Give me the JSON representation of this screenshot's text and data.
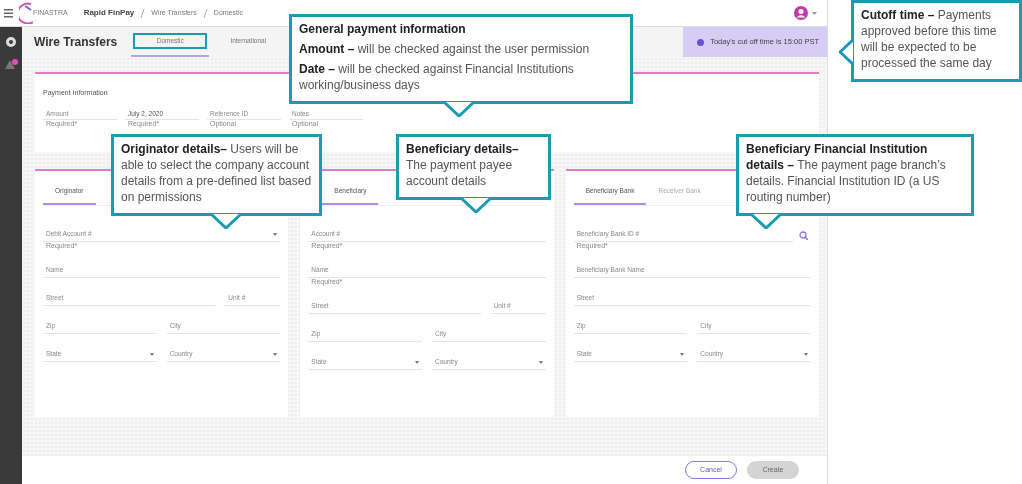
{
  "app_bar": {
    "logo": "FINASTRA",
    "app_name": "Rapid FinPay",
    "breadcrumb": [
      "Wire Transfers",
      "Domestic"
    ]
  },
  "page": {
    "title": "Wire Transfers",
    "tabs": [
      {
        "label": "Domestic",
        "selected": true,
        "highlighted": true
      },
      {
        "label": "International",
        "selected": false,
        "highlighted": false
      }
    ],
    "cutoff_banner": "Today's cut off time is 15:00 PST"
  },
  "payment_information": {
    "title": "Payment Information",
    "fields": [
      {
        "label": "Amount",
        "hint": "Required*",
        "filled": false
      },
      {
        "label": "July 2, 2020",
        "hint": "Required*",
        "filled": true
      },
      {
        "label": "Reference ID",
        "hint": "Optional",
        "filled": false
      },
      {
        "label": "Notes",
        "hint": "Optional",
        "filled": false
      }
    ]
  },
  "panels": [
    {
      "tabs": [
        {
          "label": "Originator",
          "selected": true
        }
      ],
      "rows": [
        [
          {
            "label": "Debit Account #",
            "kind": "select",
            "hint": "Required*"
          }
        ],
        [
          {
            "label": "Name",
            "kind": "text"
          }
        ],
        [
          {
            "label": "Street",
            "kind": "text"
          },
          {
            "label": "Unit #",
            "kind": "text",
            "narrow": true
          }
        ],
        [
          {
            "label": "Zip",
            "kind": "text"
          },
          {
            "label": "City",
            "kind": "text"
          }
        ],
        [
          {
            "label": "State",
            "kind": "select"
          },
          {
            "label": "Country",
            "kind": "select"
          }
        ]
      ]
    },
    {
      "tabs": [
        {
          "label": "Beneficiary",
          "selected": true
        }
      ],
      "rows": [
        [
          {
            "label": "Account #",
            "kind": "text",
            "hint": "Required*"
          }
        ],
        [
          {
            "label": "Name",
            "kind": "text",
            "hint": "Required*"
          }
        ],
        [
          {
            "label": "Street",
            "kind": "text"
          },
          {
            "label": "Unit #",
            "kind": "text",
            "narrow": true
          }
        ],
        [
          {
            "label": "Zip",
            "kind": "text"
          },
          {
            "label": "City",
            "kind": "text"
          }
        ],
        [
          {
            "label": "State",
            "kind": "select"
          },
          {
            "label": "Country",
            "kind": "select"
          }
        ]
      ]
    },
    {
      "tabs": [
        {
          "label": "Beneficiary Bank",
          "selected": true
        },
        {
          "label": "Receiver Bank",
          "selected": false
        }
      ],
      "rows": [
        [
          {
            "label": "Beneficiary Bank ID #",
            "kind": "search",
            "hint": "Required*"
          }
        ],
        [
          {
            "label": "Beneficiary Bank Name",
            "kind": "text"
          }
        ],
        [
          {
            "label": "Street",
            "kind": "text"
          }
        ],
        [
          {
            "label": "Zip",
            "kind": "text"
          },
          {
            "label": "City",
            "kind": "text"
          }
        ],
        [
          {
            "label": "State",
            "kind": "select"
          },
          {
            "label": "Country",
            "kind": "select"
          }
        ]
      ]
    }
  ],
  "footer_buttons": [
    {
      "label": "Cancel",
      "kind": "outline",
      "disabled": false
    },
    {
      "label": "Create",
      "kind": "primary",
      "disabled": true
    }
  ],
  "callouts": [
    {
      "title": "General payment information",
      "paragraphs": [
        "**Amount –** will be checked against the user permission",
        "**Date –** will be checked against Financial Institutions working/business days"
      ]
    },
    {
      "paragraphs": [
        "**Cutoff time –** Payments approved before this time will be expected to be processed the same day"
      ]
    },
    {
      "paragraphs": [
        "**Originator details–** Users will be able to select the company account details from a pre-defined list based on permissions"
      ]
    },
    {
      "paragraphs": [
        "**Beneficiary details–** The payment payee account details"
      ]
    },
    {
      "paragraphs": [
        "**Beneficiary Financial Institution details –** The payment page branch’s details. Financial Institution ID (a US routing number)"
      ]
    }
  ]
}
